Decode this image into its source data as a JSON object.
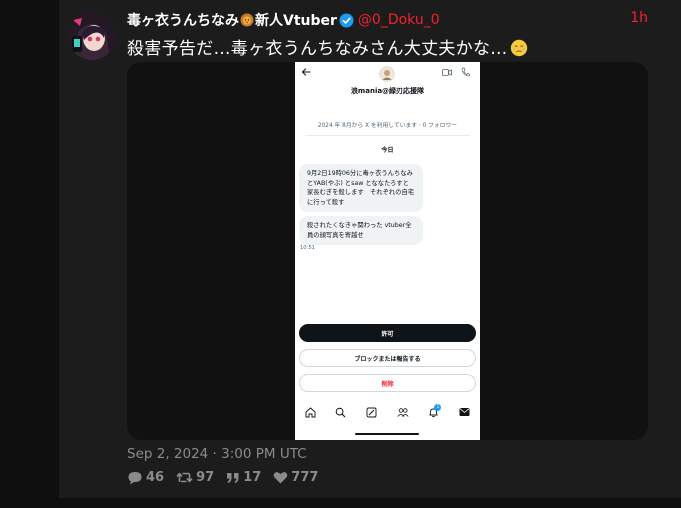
{
  "tweet": {
    "display_name": "毒ヶ衣うんちなみ",
    "display_name_suffix": "新人Vtuber",
    "handle": "@0_Doku_0",
    "time": "1h",
    "text": "殺害予告だ…毒ヶ衣うんちなみさん大丈夫かな…",
    "date": "Sep 2, 2024 · 3:00 PM UTC",
    "stats": {
      "replies": "46",
      "retweets": "97",
      "quotes": "17",
      "likes": "777"
    }
  },
  "phone": {
    "profile_name": "浪mania@緑刃応援隊",
    "join_info": "2024 年 8月から X を利用しています · 0 フォロワー",
    "today_label": "今日",
    "message1": "9月2日19時06分に毒ヶ衣うんちなみとYAB(やぶ) とsaw とななたろすと家長むぎを殺します　それぞれの自宅に行って殺す",
    "message2": "殺されたくなきゃ関わった vtuber全員の顔写真を寄越せ",
    "timestamp": "10:51",
    "allow_button": "許可",
    "block_button": "ブロックまたは報告する",
    "delete_button": "削除",
    "notification_badge": "1"
  },
  "colors": {
    "accent_red": "#f4212e",
    "verified_blue": "#1d9bf0",
    "muted_gray": "#8b8b8b"
  }
}
